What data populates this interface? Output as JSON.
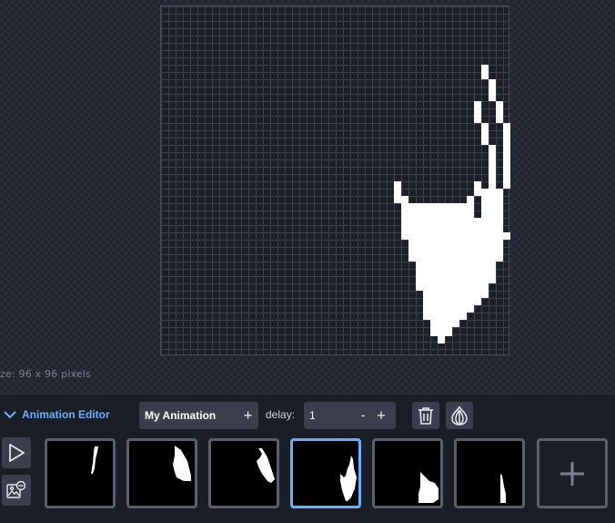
{
  "canvas": {
    "size_label": "ze: 96 x 96 pixels"
  },
  "animation_editor": {
    "title": "Animation Editor",
    "animation_name": "My Animation",
    "add_symbol": "+",
    "delay_label": "delay:",
    "delay_value": "1",
    "decrement_symbol": "-",
    "increment_symbol": "+",
    "delete_icon": "trash-icon",
    "onion_icon": "onion-skin-icon",
    "play_icon": "play-icon",
    "image_remove_icon": "image-remove-icon",
    "add_frame_icon": "plus-icon",
    "frames": [
      {
        "id": 1,
        "selected": false
      },
      {
        "id": 2,
        "selected": false
      },
      {
        "id": 3,
        "selected": false
      },
      {
        "id": 4,
        "selected": true
      },
      {
        "id": 5,
        "selected": false
      },
      {
        "id": 6,
        "selected": false
      }
    ]
  },
  "colors": {
    "accent": "#6bb0ff",
    "panel": "#1b1e27",
    "control": "#3b3f4b",
    "frame_border": "#5b606c",
    "pixel": "#ffffff"
  }
}
